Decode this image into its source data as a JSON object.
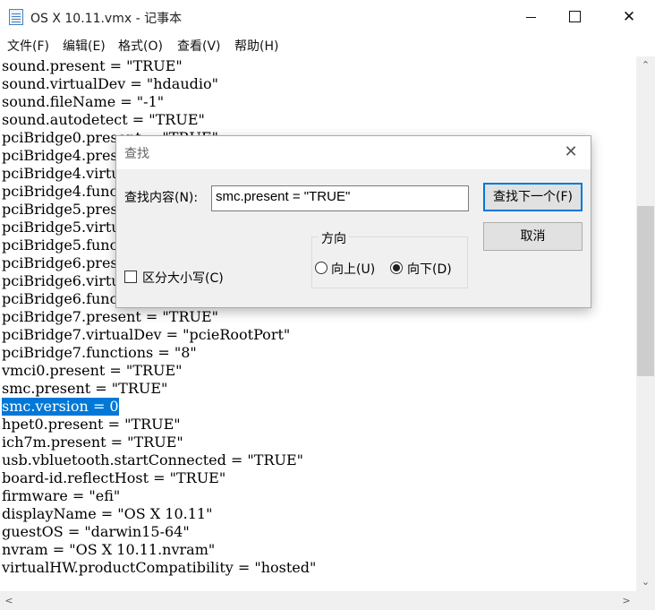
{
  "window": {
    "title": "OS X 10.11.vmx - 记事本",
    "min_glyph": "",
    "max_glyph": "",
    "close_glyph": "✕"
  },
  "menu": [
    {
      "label": "文件(F)"
    },
    {
      "label": "编辑(E)"
    },
    {
      "label": "格式(O)"
    },
    {
      "label": "查看(V)"
    },
    {
      "label": "帮助(H)"
    }
  ],
  "editor": {
    "lines": [
      "sound.present = \"TRUE\"",
      "sound.virtualDev = \"hdaudio\"",
      "sound.fileName = \"-1\"",
      "sound.autodetect = \"TRUE\"",
      "pciBridge0.present = \"TRUE\"",
      "pciBridge4.present = \"TRUE\"",
      "pciBridge4.virtualDev = \"pcieRootPort\"",
      "pciBridge4.functions = \"8\"",
      "pciBridge5.present = \"TRUE\"",
      "pciBridge5.virtualDev = \"pcieRootPort\"",
      "pciBridge5.functions = \"8\"",
      "pciBridge6.present = \"TRUE\"",
      "pciBridge6.virtualDev = \"pcieRootPort\"",
      "pciBridge6.functions = \"8\"",
      "pciBridge7.present = \"TRUE\"",
      "pciBridge7.virtualDev = \"pcieRootPort\"",
      "pciBridge7.functions = \"8\"",
      "vmci0.present = \"TRUE\"",
      "smc.present = \"TRUE\"",
      "smc.version = 0",
      "hpet0.present = \"TRUE\"",
      "ich7m.present = \"TRUE\"",
      "usb.vbluetooth.startConnected = \"TRUE\"",
      "board-id.reflectHost = \"TRUE\"",
      "firmware = \"efi\"",
      "displayName = \"OS X 10.11\"",
      "guestOS = \"darwin15-64\"",
      "nvram = \"OS X 10.11.nvram\"",
      "virtualHW.productCompatibility = \"hosted\""
    ],
    "selected_line_index": 19,
    "selection_color": "#0078d7"
  },
  "scrollbar": {
    "up_arrow": "⌃",
    "down_arrow": "⌄",
    "left_arrow": "<",
    "right_arrow": ">"
  },
  "find_dialog": {
    "title": "查找",
    "close_glyph": "✕",
    "find_label": "查找内容(N):",
    "find_value": "smc.present = \"TRUE\"",
    "find_next_label": "查找下一个(F)",
    "cancel_label": "取消",
    "direction_title": "方向",
    "up_label": "向上(U)",
    "down_label": "向下(D)",
    "direction_selected": "down",
    "match_case_label": "区分大小写(C)",
    "match_case_checked": false
  }
}
